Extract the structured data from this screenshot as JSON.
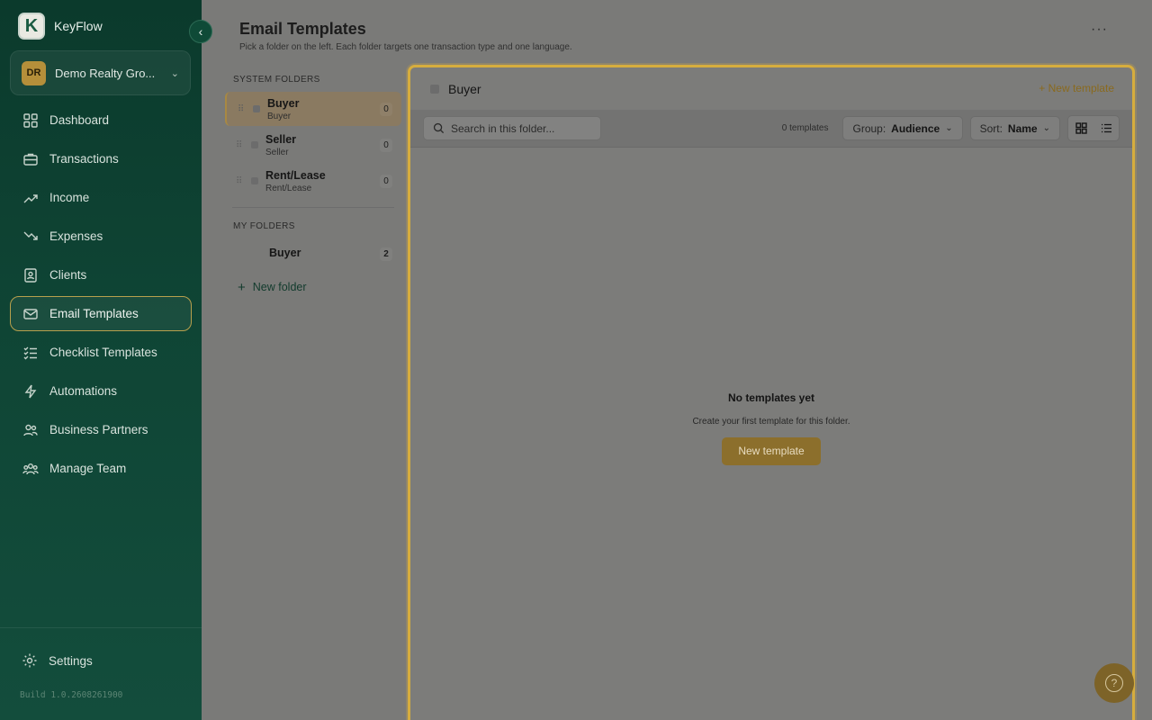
{
  "brand": {
    "logo_letter": "K",
    "name": "KeyFlow"
  },
  "org": {
    "initials": "DR",
    "name": "Demo Realty Gro..."
  },
  "nav": [
    {
      "label": "Dashboard",
      "icon": "dashboard-icon"
    },
    {
      "label": "Transactions",
      "icon": "briefcase-icon"
    },
    {
      "label": "Income",
      "icon": "trend-up-icon"
    },
    {
      "label": "Expenses",
      "icon": "trend-down-icon"
    },
    {
      "label": "Clients",
      "icon": "contacts-icon"
    },
    {
      "label": "Email Templates",
      "icon": "mail-icon",
      "active": true
    },
    {
      "label": "Checklist Templates",
      "icon": "checklist-icon"
    },
    {
      "label": "Automations",
      "icon": "bolt-icon"
    },
    {
      "label": "Business Partners",
      "icon": "partners-icon"
    },
    {
      "label": "Manage Team",
      "icon": "team-icon"
    }
  ],
  "settings_label": "Settings",
  "build": "Build 1.0.2608261900",
  "page": {
    "title": "Email Templates",
    "subtitle": "Pick a folder on the left. Each folder targets one transaction type and one language."
  },
  "folders": {
    "system_label": "SYSTEM FOLDERS",
    "system": [
      {
        "title": "Buyer",
        "sub": "Buyer",
        "count": "0"
      },
      {
        "title": "Seller",
        "sub": "Seller",
        "count": "0"
      },
      {
        "title": "Rent/Lease",
        "sub": "Rent/Lease",
        "count": "0"
      }
    ],
    "my_label": "MY FOLDERS",
    "mine": [
      {
        "title": "Buyer",
        "count": "2"
      }
    ],
    "new_folder": "New folder"
  },
  "panel": {
    "title": "Buyer",
    "new_template_link": "+ New template",
    "search_placeholder": "Search in this folder...",
    "count_text": "0 templates",
    "group_label": "Group:",
    "group_value": "Audience",
    "sort_label": "Sort:",
    "sort_value": "Name",
    "empty_title": "No templates yet",
    "empty_sub": "Create your first template for this folder.",
    "empty_button": "New template"
  },
  "colors": {
    "sidebar": "#0f4535",
    "accent": "#b8902f",
    "highlight": "#d6ad3e"
  }
}
